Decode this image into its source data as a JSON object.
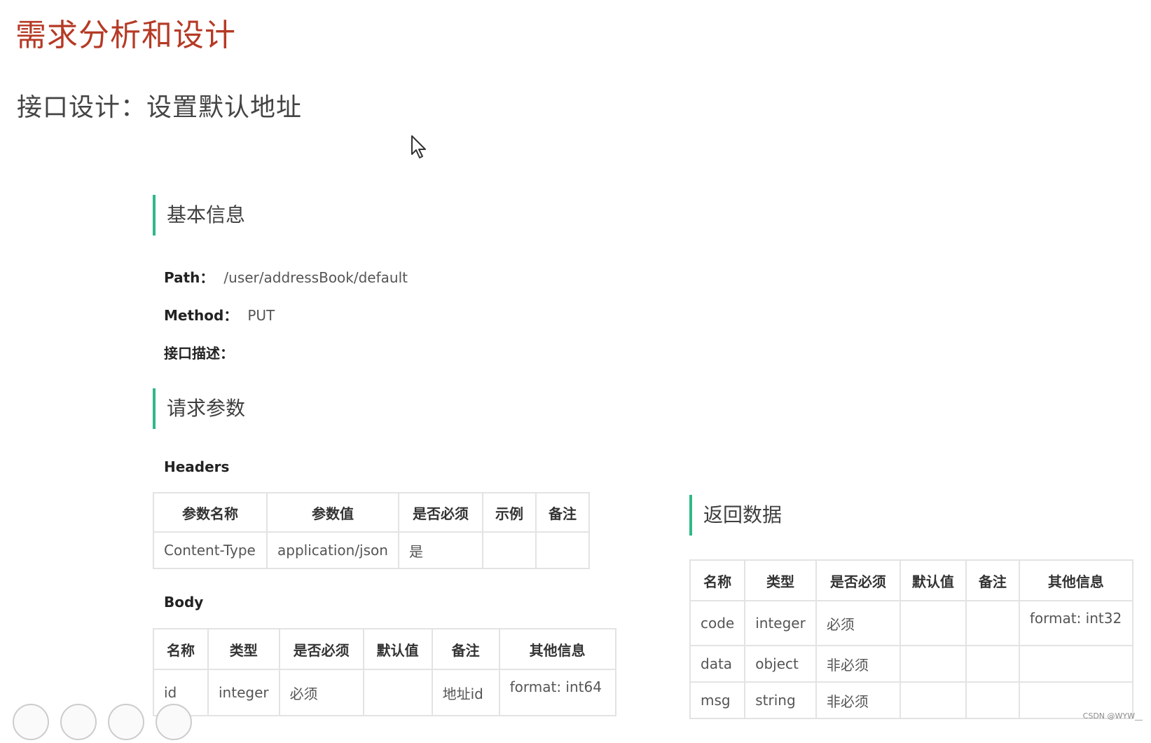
{
  "main_title": "需求分析和设计",
  "sub_title": "接口设计：设置默认地址",
  "basic_info": {
    "heading": "基本信息",
    "path_label": "Path：",
    "path_value": "/user/addressBook/default",
    "method_label": "Method：",
    "method_value": "PUT",
    "desc_label": "接口描述："
  },
  "request": {
    "heading": "请求参数",
    "headers_label": "Headers",
    "headers_table": {
      "columns": [
        "参数名称",
        "参数值",
        "是否必须",
        "示例",
        "备注"
      ],
      "rows": [
        [
          "Content-Type",
          "application/json",
          "是",
          "",
          ""
        ]
      ]
    },
    "body_label": "Body",
    "body_table": {
      "columns": [
        "名称",
        "类型",
        "是否必须",
        "默认值",
        "备注",
        "其他信息"
      ],
      "rows": [
        [
          "id",
          "integer",
          "必须",
          "",
          "地址id",
          "format: int64"
        ]
      ]
    }
  },
  "response": {
    "heading": "返回数据",
    "table": {
      "columns": [
        "名称",
        "类型",
        "是否必须",
        "默认值",
        "备注",
        "其他信息"
      ],
      "rows": [
        [
          "code",
          "integer",
          "必须",
          "",
          "",
          "format: int32"
        ],
        [
          "data",
          "object",
          "非必须",
          "",
          "",
          ""
        ],
        [
          "msg",
          "string",
          "非必须",
          "",
          "",
          ""
        ]
      ]
    }
  },
  "icons": [
    "mouse-cursor-icon",
    "pen-icon",
    "slides-icon",
    "magnifier-icon",
    "more-icon"
  ],
  "accent_color": "#2fb888",
  "title_color": "#b53a25",
  "watermark": "CSDN @WYW__"
}
